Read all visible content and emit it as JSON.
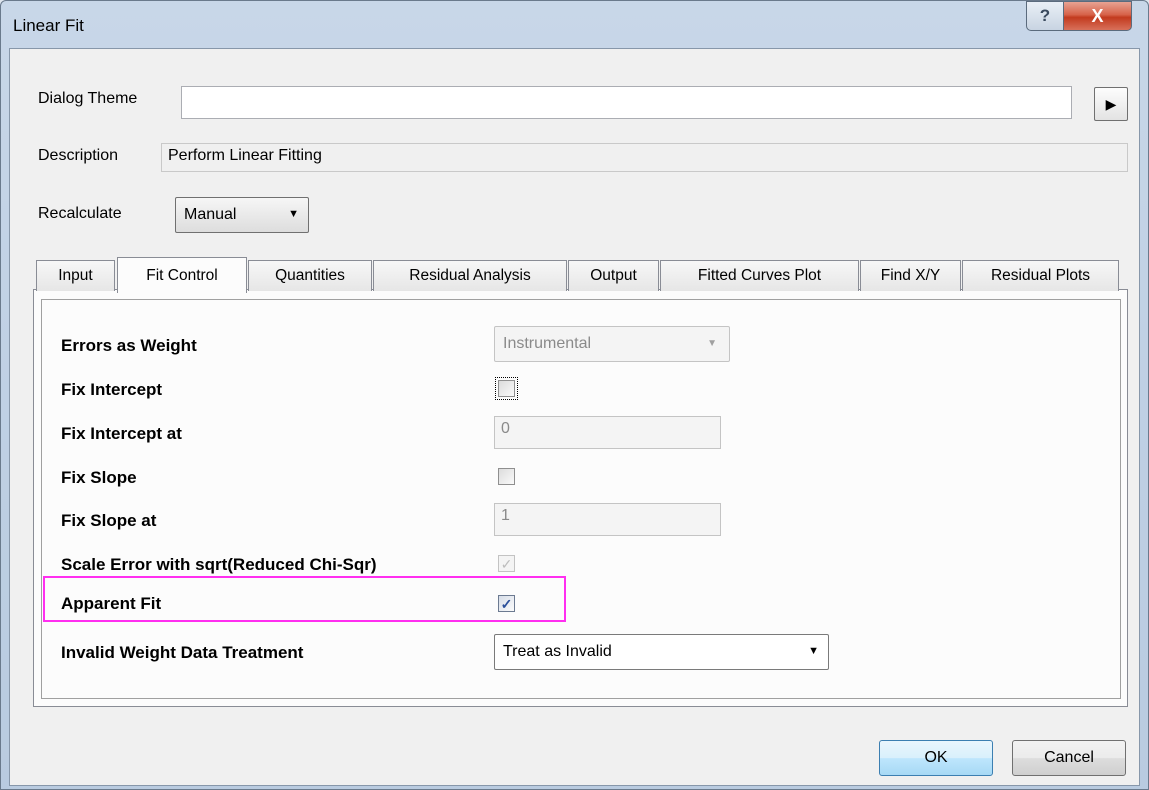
{
  "window": {
    "title": "Linear Fit",
    "help_glyph": "?",
    "close_glyph": "X"
  },
  "header": {
    "dialog_theme_label": "Dialog Theme",
    "dialog_theme_value": "",
    "theme_menu_glyph": "▶",
    "description_label": "Description",
    "description_value": "Perform Linear Fitting",
    "recalculate_label": "Recalculate",
    "recalculate_value": "Manual"
  },
  "tabs": [
    "Input",
    "Fit Control",
    "Quantities",
    "Residual Analysis",
    "Output",
    "Fitted Curves Plot",
    "Find X/Y",
    "Residual Plots"
  ],
  "active_tab": "Fit Control",
  "fit_control": {
    "errors_as_weight_label": "Errors as Weight",
    "errors_as_weight_value": "Instrumental",
    "fix_intercept_label": "Fix Intercept",
    "fix_intercept_checked": false,
    "fix_intercept_at_label": "Fix Intercept at",
    "fix_intercept_at_value": "0",
    "fix_slope_label": "Fix Slope",
    "fix_slope_checked": false,
    "fix_slope_at_label": "Fix Slope at",
    "fix_slope_at_value": "1",
    "scale_error_label": "Scale Error with sqrt(Reduced Chi-Sqr)",
    "scale_error_checked": true,
    "apparent_fit_label": "Apparent Fit",
    "apparent_fit_checked": true,
    "invalid_weight_label": "Invalid Weight Data Treatment",
    "invalid_weight_value": "Treat as Invalid",
    "check_glyph": "✓"
  },
  "buttons": {
    "ok": "OK",
    "cancel": "Cancel"
  },
  "colors": {
    "highlight": "#ff2ff0",
    "close_button": "#c23a1e"
  }
}
